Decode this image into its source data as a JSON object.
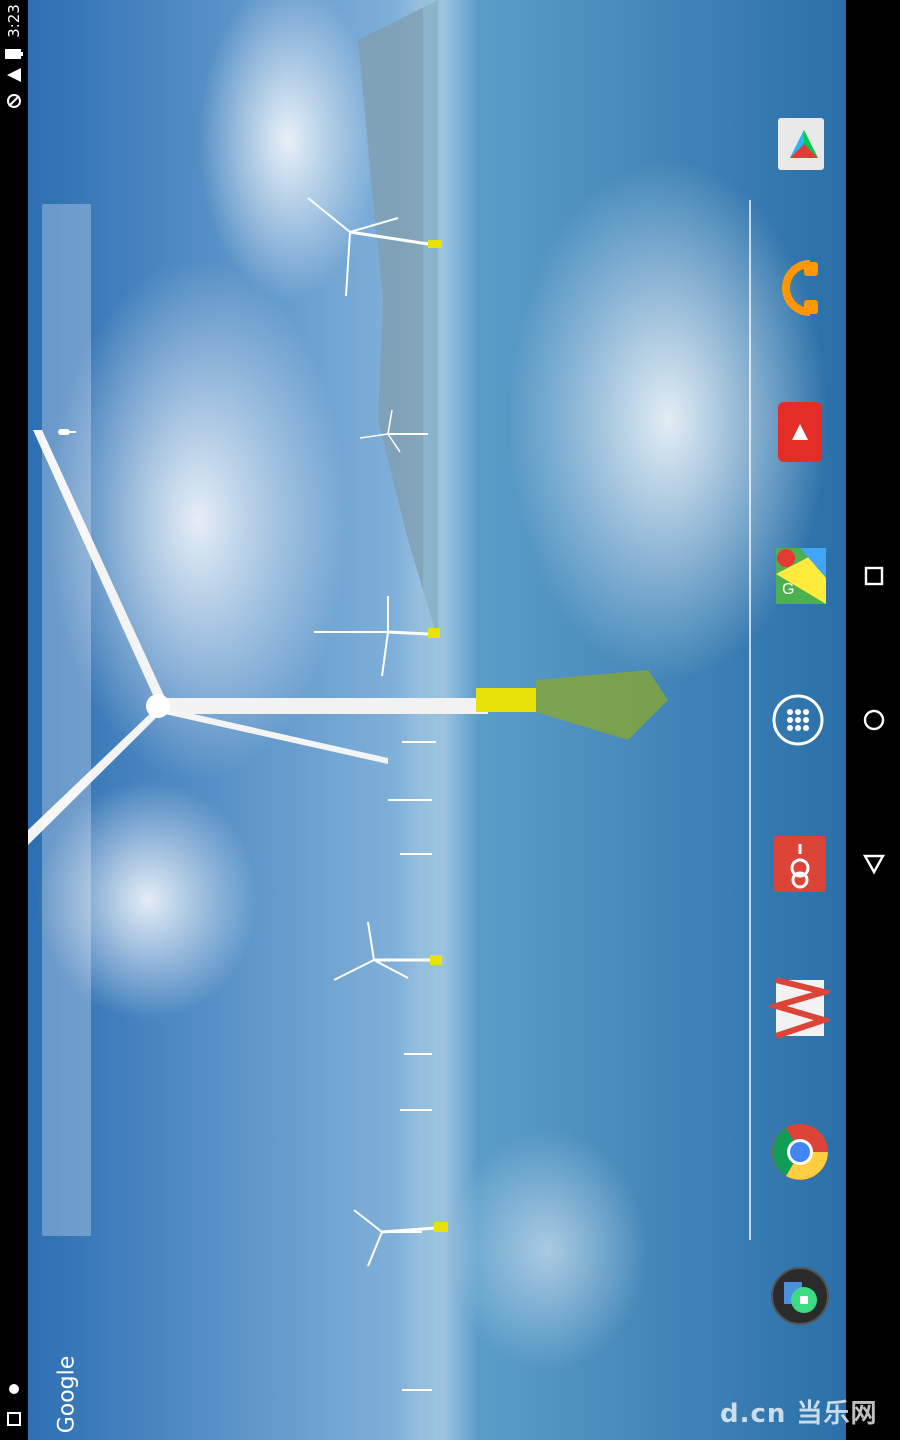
{
  "status_bar": {
    "time": "3:23",
    "icons": [
      "wifi-icon",
      "battery-icon",
      "no-sim-icon",
      "android-debug-icon",
      "notification-icon"
    ]
  },
  "search": {
    "label": "Google",
    "mic_icon": "mic-icon"
  },
  "dock": {
    "apps": [
      {
        "name": "play-store-icon"
      },
      {
        "name": "play-music-icon"
      },
      {
        "name": "youtube-icon"
      },
      {
        "name": "maps-icon"
      },
      {
        "name": "app-drawer-icon"
      },
      {
        "name": "google-plus-icon"
      },
      {
        "name": "gmail-icon"
      },
      {
        "name": "chrome-icon"
      },
      {
        "name": "folder-icon"
      }
    ]
  },
  "nav_bar": {
    "buttons": [
      "recents-button",
      "home-button",
      "back-button"
    ]
  },
  "watermark": {
    "text": "d.cn 当乐网"
  },
  "colors": {
    "sky": "#3d7fbf",
    "sea": "#2a6fa8",
    "turbine_accent": "#e8e10a"
  }
}
